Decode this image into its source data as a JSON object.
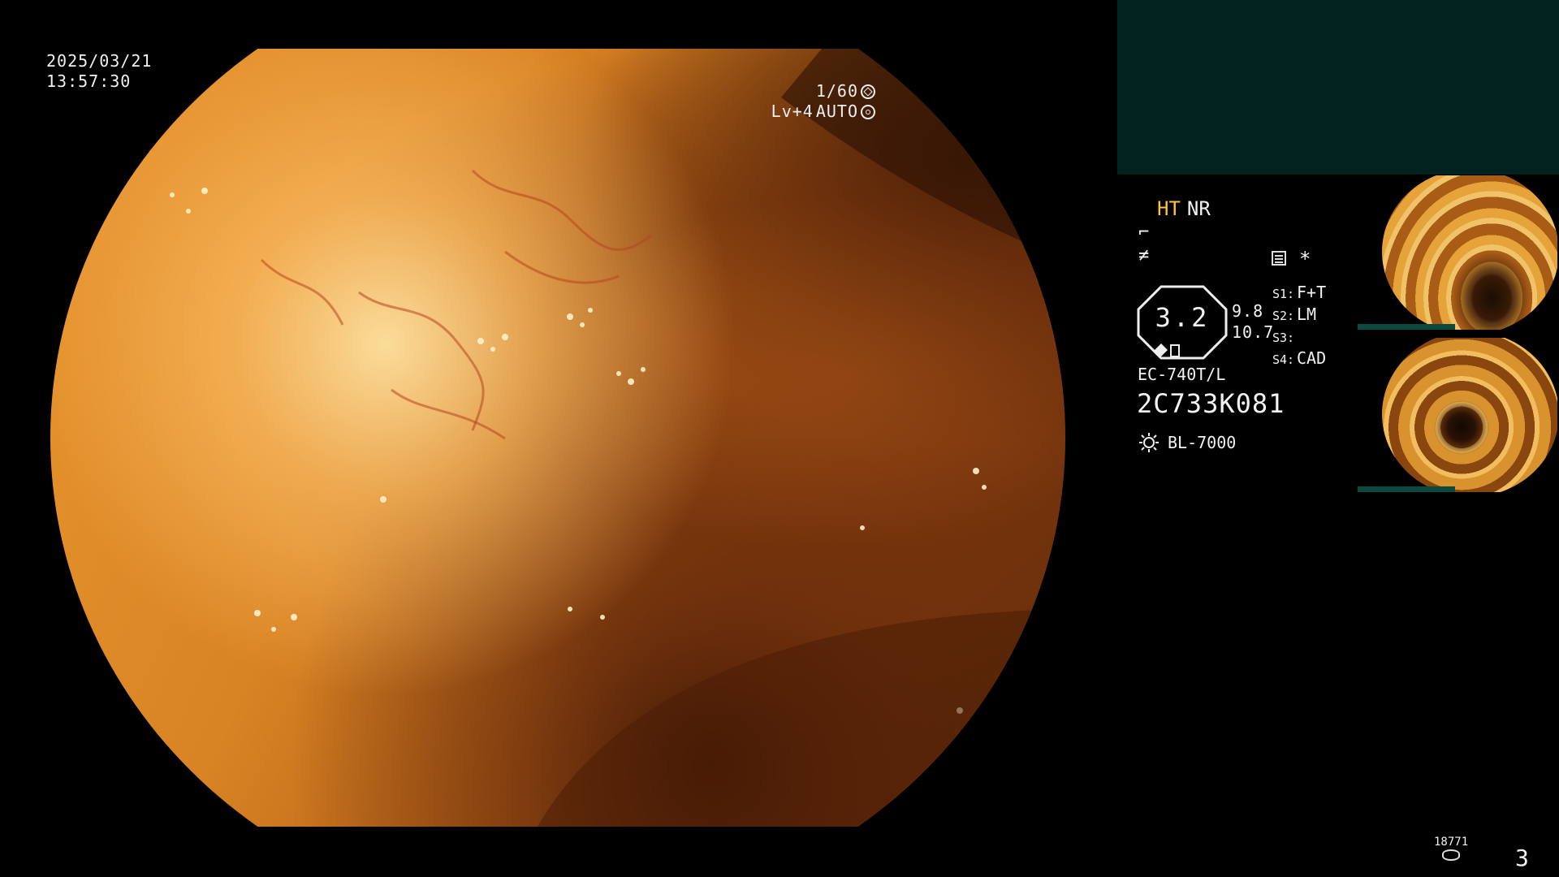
{
  "datetime": {
    "date": "2025/03/21",
    "time": "13:57:30"
  },
  "exposure": {
    "shutter": "1/60",
    "level": "Lv+4",
    "mode": "AUTO"
  },
  "image_modes": {
    "ht": "HT",
    "nr": "NR"
  },
  "zoom": {
    "value": "3.2",
    "upper": "9.8",
    "lower": "10.7"
  },
  "switches": [
    {
      "key": "S1:",
      "value": "F+T"
    },
    {
      "key": "S2:",
      "value": "LM"
    },
    {
      "key": "S3:",
      "value": ""
    },
    {
      "key": "S4:",
      "value": "CAD"
    }
  ],
  "scope": {
    "model": "EC-740T/L",
    "serial": "2C733K081"
  },
  "light_source": "BL-7000",
  "storage": {
    "count": "18771"
  },
  "page_number": "3",
  "icons": {
    "shutter": "shutter-icon",
    "iris": "iris-icon",
    "enhancement_1": "structure-enhance-icon",
    "enhancement_2": "edge-enhance-icon",
    "keyboard": "keyboard-icon",
    "asterisk": "asterisk-icon",
    "light": "light-source-icon",
    "storage": "storage-icon"
  },
  "colors": {
    "ht_label": "#ffc23a",
    "top_panel": "#02221f",
    "thumb_bar": "#0c4a40"
  }
}
